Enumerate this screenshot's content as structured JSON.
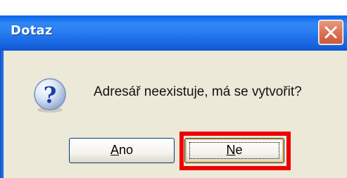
{
  "dialog": {
    "title": "Dotaz",
    "message": "Adresář neexistuje, má se vytvořit?",
    "icon": "question-icon",
    "buttons": {
      "ano": {
        "first": "A",
        "rest": "no"
      },
      "ne": {
        "first": "N",
        "rest": "e"
      }
    }
  },
  "colors": {
    "titlebar": "#2a7ff2",
    "body": "#ece9d8",
    "highlight": "#ee0000",
    "close": "#d9714f"
  }
}
